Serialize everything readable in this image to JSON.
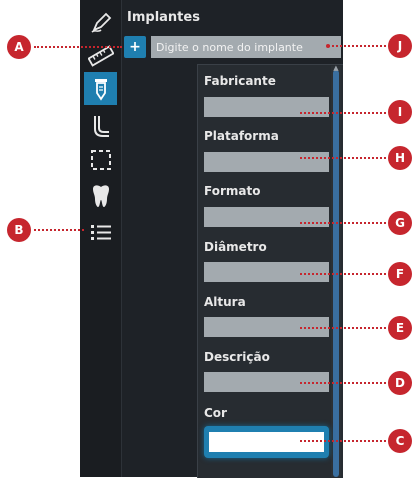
{
  "panel": {
    "title": "Implantes"
  },
  "search": {
    "add_label": "+",
    "placeholder": "Digite o nome do implante"
  },
  "toolbar": {
    "tools": [
      "pen-icon",
      "ruler-icon",
      "implant-icon",
      "canal-icon",
      "selection-icon",
      "tooth-icon",
      "list-icon"
    ],
    "active": "implant-icon"
  },
  "form": {
    "fabricante_label": "Fabricante",
    "plataforma_label": "Plataforma",
    "formato_label": "Formato",
    "diametro_label": "Diâmetro",
    "altura_label": "Altura",
    "descricao_label": "Descrição",
    "cor_label": "Cor",
    "cor_value": "#ffffff"
  },
  "callouts": [
    "A",
    "B",
    "C",
    "D",
    "E",
    "F",
    "G",
    "H",
    "I",
    "J"
  ],
  "colors": {
    "accent": "#1f7fb0",
    "callout": "#c6262e",
    "field": "#a3aaaf",
    "panel": "#1e2227"
  }
}
